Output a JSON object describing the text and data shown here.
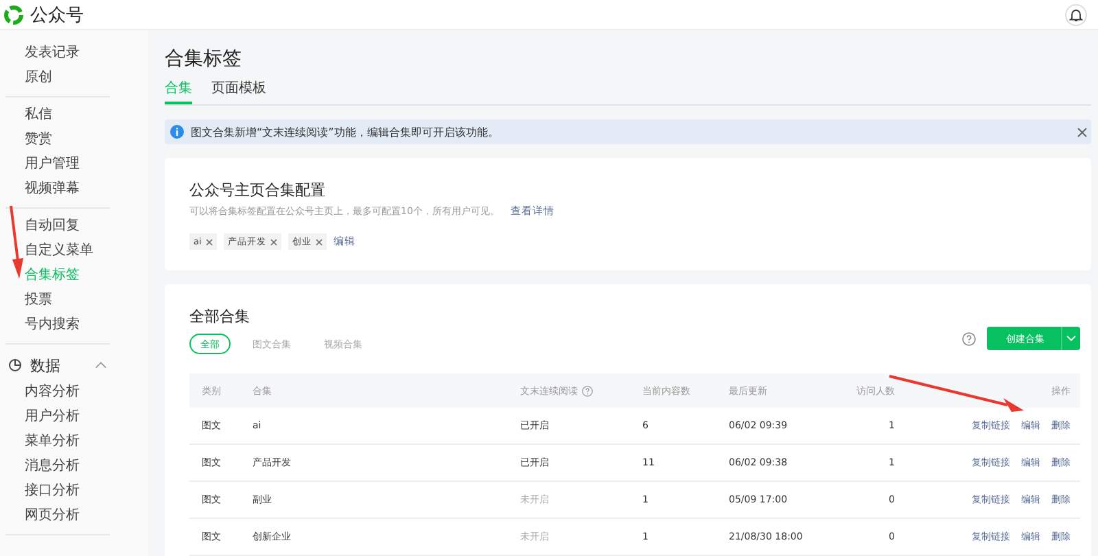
{
  "header": {
    "logo_text": "公众号"
  },
  "sidebar": {
    "groups": [
      [
        {
          "label": "发表记录",
          "selected": false
        },
        {
          "label": "原创",
          "selected": false
        }
      ],
      [
        {
          "label": "私信",
          "selected": false
        },
        {
          "label": "赞赏",
          "selected": false
        },
        {
          "label": "用户管理",
          "selected": false
        },
        {
          "label": "视频弹幕",
          "selected": false
        }
      ],
      [
        {
          "label": "自动回复",
          "selected": false
        },
        {
          "label": "自定义菜单",
          "selected": false
        },
        {
          "label": "合集标签",
          "selected": true
        },
        {
          "label": "投票",
          "selected": false
        },
        {
          "label": "号内搜索",
          "selected": false
        }
      ]
    ],
    "section": {
      "title": "数据",
      "expanded": true,
      "items": [
        {
          "label": "内容分析",
          "selected": false
        },
        {
          "label": "用户分析",
          "selected": false
        },
        {
          "label": "菜单分析",
          "selected": false
        },
        {
          "label": "消息分析",
          "selected": false
        },
        {
          "label": "接口分析",
          "selected": false
        },
        {
          "label": "网页分析",
          "selected": false
        }
      ]
    }
  },
  "page": {
    "title": "合集标签",
    "tabs": [
      {
        "label": "合集",
        "selected": true
      },
      {
        "label": "页面模板",
        "selected": false
      }
    ],
    "notice": "图文合集新增“文末连续阅读”功能，编辑合集即可开启该功能。",
    "config": {
      "title": "公众号主页合集配置",
      "description": "可以将合集标签配置在公众号主页上，最多可配置10个，所有用户可见。",
      "details_link": "查看详情",
      "tags": [
        "ai",
        "产品开发",
        "创业"
      ],
      "edit_link": "编辑"
    },
    "collections": {
      "title": "全部合集",
      "filters": [
        {
          "label": "全部",
          "selected": true
        },
        {
          "label": "图文合集",
          "selected": false
        },
        {
          "label": "视频合集",
          "selected": false
        }
      ],
      "create_button": "创建合集",
      "columns": [
        "类别",
        "合集",
        "文末连续阅读",
        "当前内容数",
        "最后更新",
        "访问人数",
        "操作"
      ],
      "rows": [
        {
          "category": "图文",
          "name": "ai",
          "reading": {
            "text": "已开启",
            "enabled": true
          },
          "count": "6",
          "updated": "06/02 09:39",
          "visitors": "1",
          "actions": [
            "复制链接",
            "编辑",
            "删除"
          ]
        },
        {
          "category": "图文",
          "name": "产品开发",
          "reading": {
            "text": "已开启",
            "enabled": true
          },
          "count": "11",
          "updated": "06/02 09:38",
          "visitors": "1",
          "actions": [
            "复制链接",
            "编辑",
            "删除"
          ]
        },
        {
          "category": "图文",
          "name": "副业",
          "reading": {
            "text": "未开启",
            "enabled": false
          },
          "count": "1",
          "updated": "05/09 17:00",
          "visitors": "0",
          "actions": [
            "复制链接",
            "编辑",
            "删除"
          ]
        },
        {
          "category": "图文",
          "name": "创新企业",
          "reading": {
            "text": "未开启",
            "enabled": false
          },
          "count": "1",
          "updated": "21/08/30 18:00",
          "visitors": "0",
          "actions": [
            "复制链接",
            "编辑",
            "删除"
          ]
        }
      ]
    }
  }
}
